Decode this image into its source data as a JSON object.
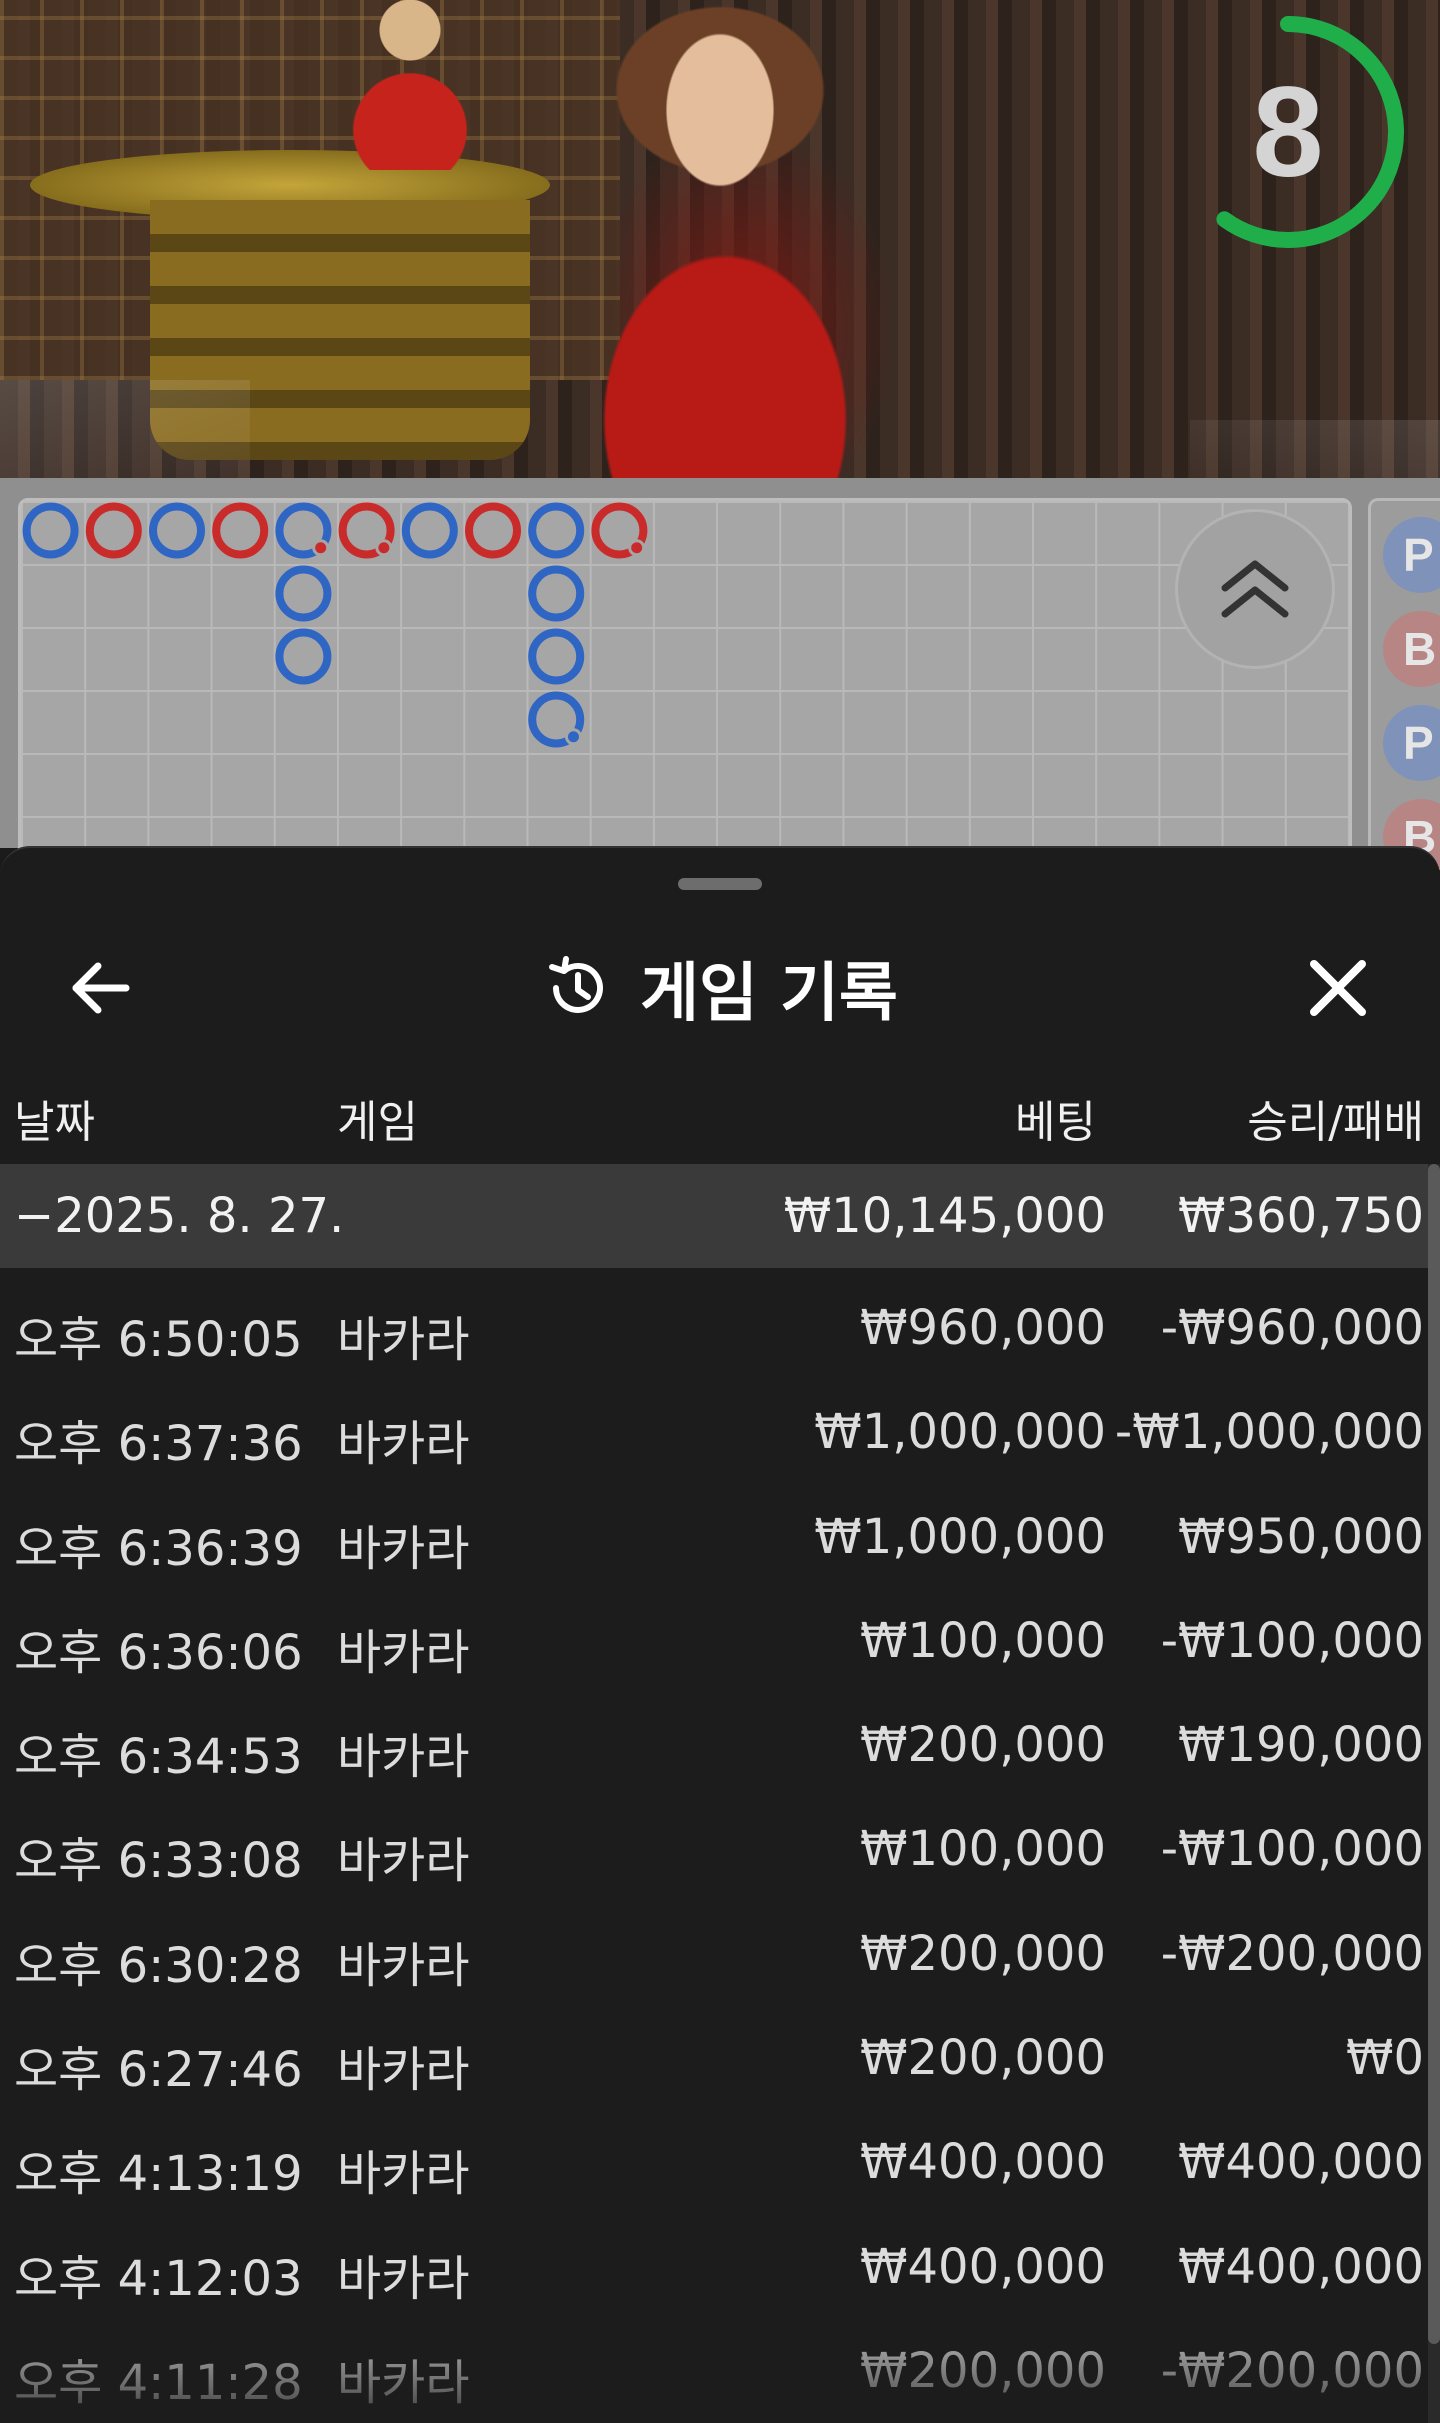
{
  "video": {
    "countdown": "8",
    "countdown_progress": 0.6,
    "countdown_color": "#1fae49"
  },
  "roadmap": {
    "player_color": "#2f66c4",
    "banker_color": "#c92b2b",
    "columns": [
      [
        {
          "r": "P"
        }
      ],
      [
        {
          "r": "B"
        }
      ],
      [
        {
          "r": "P"
        }
      ],
      [
        {
          "r": "B"
        }
      ],
      [
        {
          "r": "P",
          "dot": "B"
        },
        {
          "r": "P"
        },
        {
          "r": "P"
        }
      ],
      [
        {
          "r": "B",
          "dot": "B"
        }
      ],
      [
        {
          "r": "P"
        }
      ],
      [
        {
          "r": "B"
        }
      ],
      [
        {
          "r": "P"
        },
        {
          "r": "P"
        },
        {
          "r": "P"
        },
        {
          "r": "P",
          "dot": "P"
        }
      ],
      [
        {
          "r": "B",
          "dot": "B"
        }
      ]
    ],
    "side_pills": [
      "P",
      "B",
      "P",
      "B"
    ]
  },
  "panel": {
    "title": "게임 기록",
    "icons": {
      "back": "arrow-left-icon",
      "history": "history-icon",
      "close": "close-icon",
      "scroll_up": "double-chevron-up-icon"
    },
    "columns": {
      "date": "날짜",
      "game": "게임",
      "bet": "베팅",
      "result": "승리/패배"
    },
    "summary": {
      "date": "−2025. 8. 27.",
      "bet": "₩10,145,000",
      "result": "₩360,750"
    },
    "rows": [
      {
        "time": "오후 6:50:05",
        "game": "바카라",
        "bet": "₩960,000",
        "result": "-₩960,000"
      },
      {
        "time": "오후 6:37:36",
        "game": "바카라",
        "bet": "₩1,000,000",
        "result": "-₩1,000,000"
      },
      {
        "time": "오후 6:36:39",
        "game": "바카라",
        "bet": "₩1,000,000",
        "result": "₩950,000"
      },
      {
        "time": "오후 6:36:06",
        "game": "바카라",
        "bet": "₩100,000",
        "result": "-₩100,000"
      },
      {
        "time": "오후 6:34:53",
        "game": "바카라",
        "bet": "₩200,000",
        "result": "₩190,000"
      },
      {
        "time": "오후 6:33:08",
        "game": "바카라",
        "bet": "₩100,000",
        "result": "-₩100,000"
      },
      {
        "time": "오후 6:30:28",
        "game": "바카라",
        "bet": "₩200,000",
        "result": "-₩200,000"
      },
      {
        "time": "오후 6:27:46",
        "game": "바카라",
        "bet": "₩200,000",
        "result": "₩0"
      },
      {
        "time": "오후 4:13:19",
        "game": "바카라",
        "bet": "₩400,000",
        "result": "₩400,000"
      },
      {
        "time": "오후 4:12:03",
        "game": "바카라",
        "bet": "₩400,000",
        "result": "₩400,000"
      },
      {
        "time": "오후 4:11:28",
        "game": "바카라",
        "bet": "₩200,000",
        "result": "-₩200,000"
      }
    ]
  }
}
